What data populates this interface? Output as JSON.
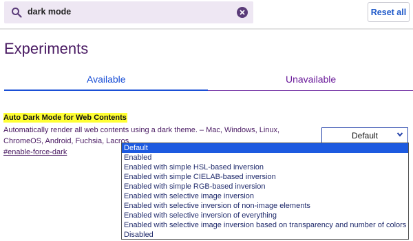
{
  "search": {
    "value": "dark mode"
  },
  "header": {
    "reset_label": "Reset all"
  },
  "page": {
    "title": "Experiments"
  },
  "tabs": [
    {
      "label": "Available",
      "active": true
    },
    {
      "label": "Unavailable",
      "active": false
    }
  ],
  "experiment": {
    "title": "Auto Dark Mode for Web Contents",
    "description": "Automatically render all web contents using a dark theme. – Mac, Windows, Linux, ChromeOS, Android, Fuchsia, Lacros",
    "link": "#enable-force-dark",
    "selected_value": "Default",
    "options": [
      "Default",
      "Enabled",
      "Enabled with simple HSL-based inversion",
      "Enabled with simple CIELAB-based inversion",
      "Enabled with simple RGB-based inversion",
      "Enabled with selective image inversion",
      "Enabled with selective inversion of non-image elements",
      "Enabled with selective inversion of everything",
      "Enabled with selective image inversion based on transparency and number of colors",
      "Disabled"
    ]
  },
  "colors": {
    "title": "#4a1b63",
    "accent": "#1a4fd6",
    "highlight": "#ffff33",
    "search_bg": "#eee7f3",
    "selected_option": "#1d5ae0"
  }
}
